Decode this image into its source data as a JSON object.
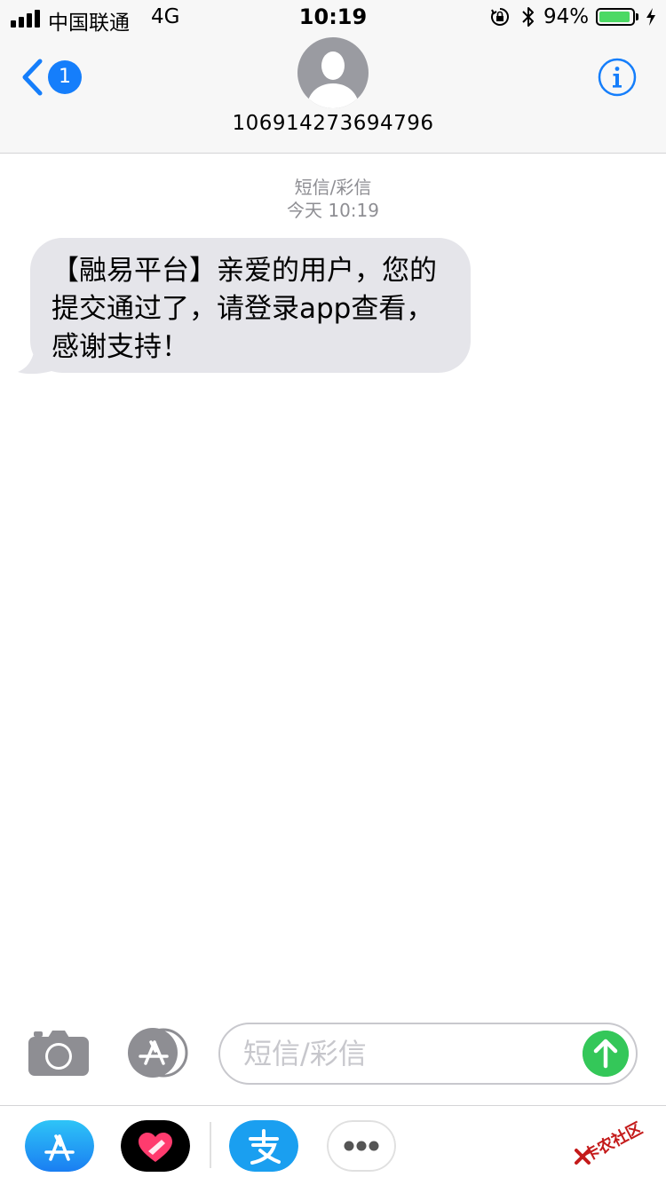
{
  "status_bar": {
    "carrier": "中国联通",
    "network": "4G",
    "time": "10:19",
    "battery_pct": "94%",
    "battery_level": 0.94
  },
  "header": {
    "back_badge": "1",
    "contact": "106914273694796"
  },
  "conversation": {
    "service": "短信/彩信",
    "timestamp": "今天 10:19",
    "messages": [
      {
        "direction": "incoming",
        "text": "【融易平台】亲爱的用户，您的提交通过了，请登录app查看，感谢支持！"
      }
    ]
  },
  "input_bar": {
    "placeholder": "短信/彩信"
  },
  "app_drawer": {
    "apps": [
      "app-store-icon",
      "heart-icon",
      "alipay-icon",
      "more-icon"
    ]
  },
  "watermark": {
    "text": "卡农社区"
  },
  "colors": {
    "accent": "#157efb",
    "bubble": "#e5e5ea",
    "send": "#34c759",
    "battery": "#4cd964",
    "meta_text": "#8e8e93"
  }
}
